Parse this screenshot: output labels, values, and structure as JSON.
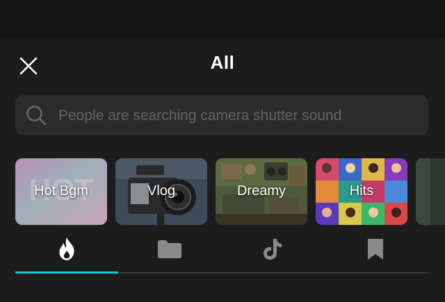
{
  "header": {
    "title": "All"
  },
  "search": {
    "placeholder": "People are searching camera shutter sound",
    "value": ""
  },
  "categories": [
    {
      "label": "Hot Bgm"
    },
    {
      "label": "Vlog"
    },
    {
      "label": "Dreamy"
    },
    {
      "label": "Hits"
    }
  ],
  "tabs": [
    {
      "icon": "flame-icon",
      "active": true
    },
    {
      "icon": "folder-icon",
      "active": false
    },
    {
      "icon": "tiktok-icon",
      "active": false
    },
    {
      "icon": "bookmark-icon",
      "active": false
    }
  ],
  "colors": {
    "background": "#1c1c1c",
    "accent": "#19c7d8",
    "search_bg": "#2b2b2b",
    "inactive_icon": "#8a8a8a"
  }
}
